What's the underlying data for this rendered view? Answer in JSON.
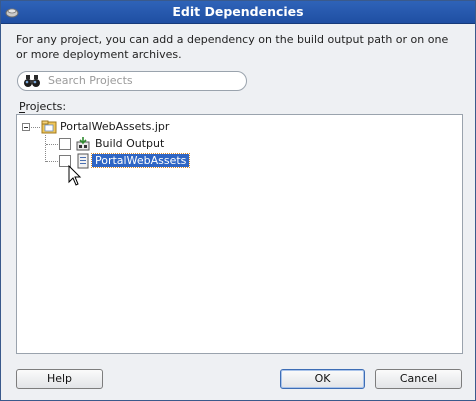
{
  "window": {
    "title": "Edit Dependencies",
    "icon": "dialog-app-icon"
  },
  "description": "For any project, you can add a dependency on the build output path or on one or more deployment archives.",
  "search": {
    "placeholder": "Search Projects",
    "value": "",
    "icon": "binoculars-icon"
  },
  "projects": {
    "label": "Projects:",
    "tree": [
      {
        "label": "PortalWebAssets.jpr",
        "icon": "project-folder-icon",
        "expanded": true
      },
      {
        "label": "Build Output",
        "icon": "build-output-icon",
        "checked": false
      },
      {
        "label": "PortalWebAssets",
        "icon": "deployment-archive-icon",
        "checked": false,
        "selected": true
      }
    ]
  },
  "buttons": {
    "help": "Help",
    "ok": "OK",
    "cancel": "Cancel"
  },
  "colors": {
    "titlebar": "#1f4fa3",
    "selection": "#2f65c4"
  }
}
